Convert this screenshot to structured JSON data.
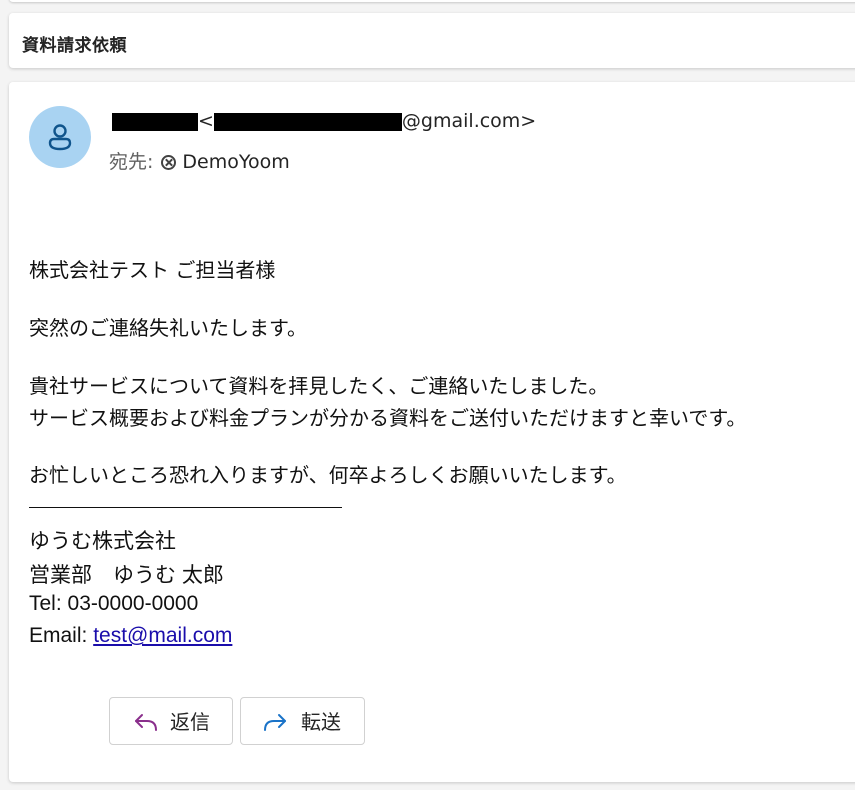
{
  "subject": "資料請求依頼",
  "sender": {
    "email_domain": "@gmail.com>",
    "email_prefix": "<"
  },
  "recipient": {
    "label": "宛先:",
    "name": "DemoYoom"
  },
  "body": {
    "greeting": "株式会社テスト ご担当者様",
    "line1": "突然のご連絡失礼いたします。",
    "line2a": "貴社サービスについて資料を拝見したく、ご連絡いたしました。",
    "line2b": "サービス概要および料金プランが分かる資料をご送付いただけますと幸いです。",
    "line3": "お忙しいところ恐れ入りますが、何卒よろしくお願いいたします。"
  },
  "signature": {
    "company": "ゆうむ株式会社",
    "dept_name": "営業部　ゆうむ 太郎",
    "tel": "Tel: 03-0000-0000",
    "email_label": "Email: ",
    "email": "test@mail.com"
  },
  "actions": {
    "reply_label": "返信",
    "forward_label": "転送"
  },
  "colors": {
    "avatar_bg": "#a9d3f2",
    "avatar_icon": "#0f548c",
    "reply_icon": "#8a2f8c",
    "forward_icon": "#1a73c8",
    "link": "#1a0dab"
  },
  "icons": {
    "avatar": "person-icon",
    "recipient_remove": "dismiss-circle-icon",
    "reply": "reply-arrow-icon",
    "forward": "forward-arrow-icon"
  }
}
